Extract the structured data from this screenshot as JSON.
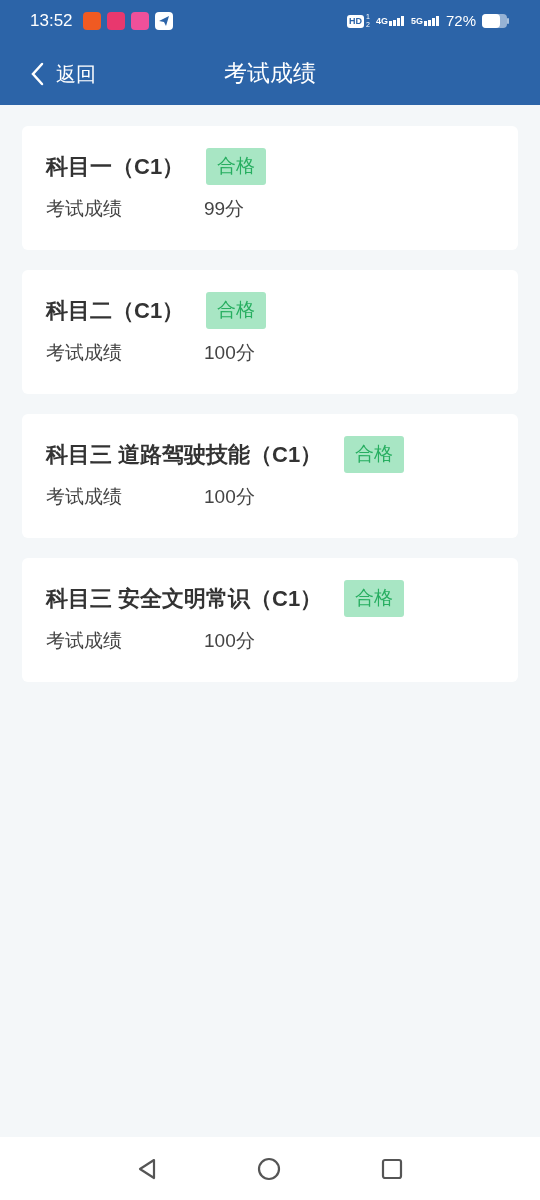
{
  "status_bar": {
    "time": "13:52",
    "hd": "HD",
    "hd_sup": "1",
    "hd_sub": "2",
    "networks": [
      "4G",
      "5G"
    ],
    "battery": "72%"
  },
  "header": {
    "back": "返回",
    "title": "考试成绩"
  },
  "results": [
    {
      "subject": "科目一（C1）",
      "status": {
        "kind": "pass",
        "label": "合格"
      },
      "label": "考试成绩",
      "score": "99分"
    },
    {
      "subject": "科目二（C1）",
      "status": {
        "kind": "pass",
        "label": "合格"
      },
      "label": "考试成绩",
      "score": "100分"
    },
    {
      "subject": "科目三 道路驾驶技能（C1）",
      "status": {
        "kind": "pass",
        "label": "合格"
      },
      "label": "考试成绩",
      "score": "100分"
    },
    {
      "subject": "科目三 安全文明常识（C1）",
      "status": {
        "kind": "pass",
        "label": "合格"
      },
      "label": "考试成绩",
      "score": "100分"
    }
  ]
}
